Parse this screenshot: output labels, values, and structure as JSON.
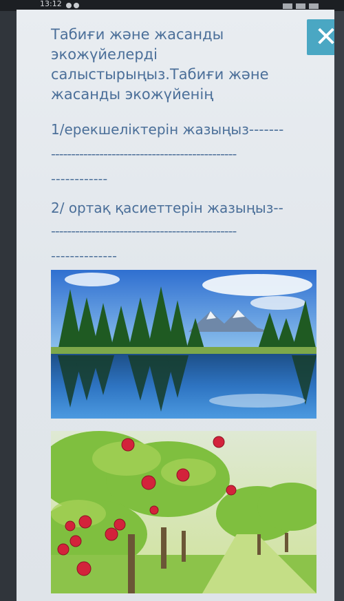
{
  "status_bar": {
    "time": "13:12"
  },
  "question": {
    "intro_lines": [
      "Табиғи және жасанды",
      "экожүйелерді",
      "салыстырыңыз.Табиғи және",
      "жасанды экожүйенің"
    ],
    "item1_line1": "1/ерекшеліктерін жазыңыз-------",
    "item1_line2": "----------------------------------------------",
    "item1_line3": "------------",
    "item2_line1": "2/ ортақ қасиеттерін жазыңыз--",
    "item2_line2": "----------------------------------------------",
    "item2_line3": "--------------"
  },
  "close_button": {
    "label": "✕",
    "icon": "close-icon",
    "color": "#4aa7c3"
  },
  "images": {
    "natural": {
      "alt_icon": "lake-forest-landscape-image"
    },
    "artificial": {
      "alt_icon": "apple-orchard-image"
    }
  }
}
